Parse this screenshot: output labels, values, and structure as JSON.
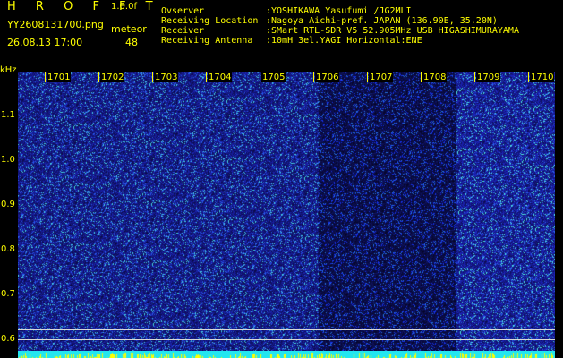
{
  "header": {
    "logo": "H R O F F T",
    "version": "1.0.0f",
    "filename": "YY2608131700.png",
    "meteor_label": "meteor",
    "datetime": "26.08.13 17:00",
    "meteor_count": "48"
  },
  "info": [
    {
      "key": "Ovserver",
      "value": ":YOSHIKAWA Yasufumi /JG2MLI"
    },
    {
      "key": "Receiving Location",
      "value": ":Nagoya Aichi-pref. JAPAN (136.90E, 35.20N)"
    },
    {
      "key": "Receiver",
      "value": ":SMart RTL-SDR V5 52.905MHz USB HIGASHIMURAYAMA"
    },
    {
      "key": "Receiving Antenna",
      "value": ":10mH 3el.YAGI Horizontal:ENE"
    }
  ],
  "axis": {
    "unit": "kHz",
    "y_ticks": [
      "1.1",
      "1.0",
      "0.9",
      "0.8",
      "0.7",
      "0.6"
    ],
    "x_ticks": [
      "1701",
      "1702",
      "1703",
      "1704",
      "1705",
      "1706",
      "1707",
      "1708",
      "1709",
      "1710"
    ]
  },
  "colors": {
    "label": "#ffff00",
    "background": "#000000",
    "noise_base": "#1a1aa8",
    "noise_speck": "#3fd0e0",
    "band_lines": "#d8d8d8"
  }
}
